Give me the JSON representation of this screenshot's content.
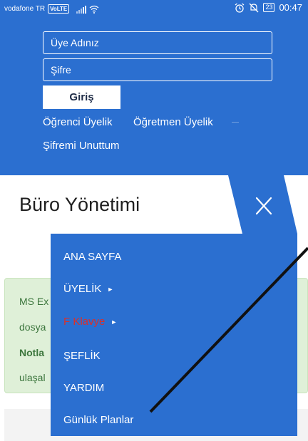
{
  "status_bar": {
    "carrier": "vodafone TR",
    "volte": "VoLTE",
    "battery": "23",
    "time": "00:47"
  },
  "login": {
    "username_placeholder": "Üye Adınız",
    "password_placeholder": "Şifre",
    "login_button": "Giriş",
    "student_signup": "Öğrenci Üyelik",
    "teacher_signup": "Öğretmen Üyelik",
    "forgot_password": "Şifremi Unuttum"
  },
  "page_title": "Büro Yönetimi",
  "close_icon": "close-icon",
  "alert": {
    "line1": "MS Ex",
    "line2": "dosya",
    "line3": "Notla",
    "line4": "ulaşal"
  },
  "menu": {
    "items": [
      {
        "label": "ANA SAYFA",
        "has_submenu": false
      },
      {
        "label": "ÜYELİK",
        "has_submenu": true
      },
      {
        "label": "F Klavye",
        "has_submenu": true,
        "color": "#d9302b"
      },
      {
        "label": "ŞEFLİK",
        "has_submenu": false
      },
      {
        "label": "YARDIM",
        "has_submenu": false
      },
      {
        "label": "Günlük Planlar",
        "has_submenu": false
      }
    ]
  },
  "colors": {
    "primary": "#2b6fd0",
    "alert_bg": "#dff0d8",
    "alert_text": "#3c763d",
    "highlight_red": "#d9302b"
  }
}
